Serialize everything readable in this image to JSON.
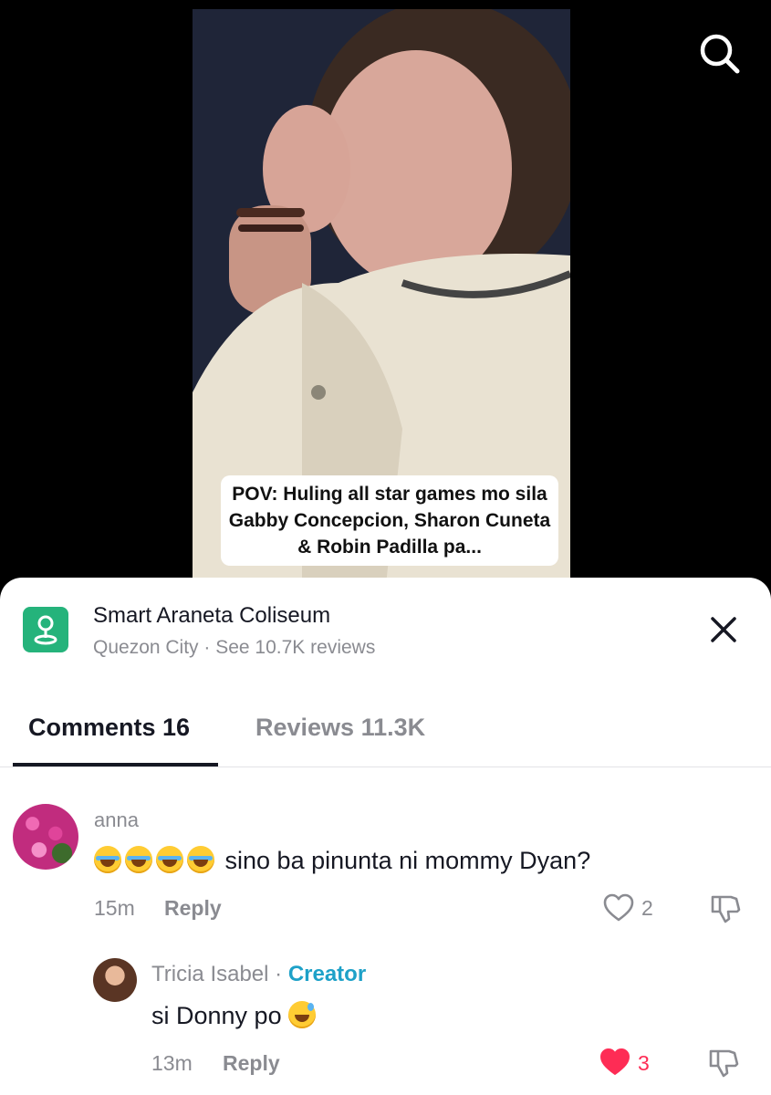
{
  "video": {
    "caption": "POV: Huling all star games mo sila Gabby Concepcion, Sharon Cuneta & Robin Padilla pa..."
  },
  "icons": {
    "search": "search-icon",
    "location": "location-pin-icon",
    "close": "close-icon",
    "like": "heart-icon",
    "dislike": "thumbs-down-icon"
  },
  "location": {
    "name": "Smart Araneta Coliseum",
    "city": "Quezon City",
    "separator": " · ",
    "reviews_link": "See 10.7K reviews"
  },
  "tabs": [
    {
      "label": "Comments 16",
      "active": true
    },
    {
      "label": "Reviews 11.3K",
      "active": false
    }
  ],
  "comments": [
    {
      "username": "anna",
      "text": "sino ba pinunta ni mommy Dyan?",
      "emoji": "face-with-tears-of-joy",
      "time": "15m",
      "reply_label": "Reply",
      "likes": "2",
      "liked": false
    },
    {
      "username": "Tricia Isabel",
      "separator": " · ",
      "badge": "Creator",
      "text": "si Donny po",
      "emoji": "grinning-face-with-sweat",
      "time": "13m",
      "reply_label": "Reply",
      "likes": "3",
      "liked": true
    }
  ],
  "colors": {
    "accent_like": "#fe2c55",
    "creator_badge": "#1ea1c8",
    "location_icon": "#25b37b",
    "muted_text": "#8a8b91"
  }
}
